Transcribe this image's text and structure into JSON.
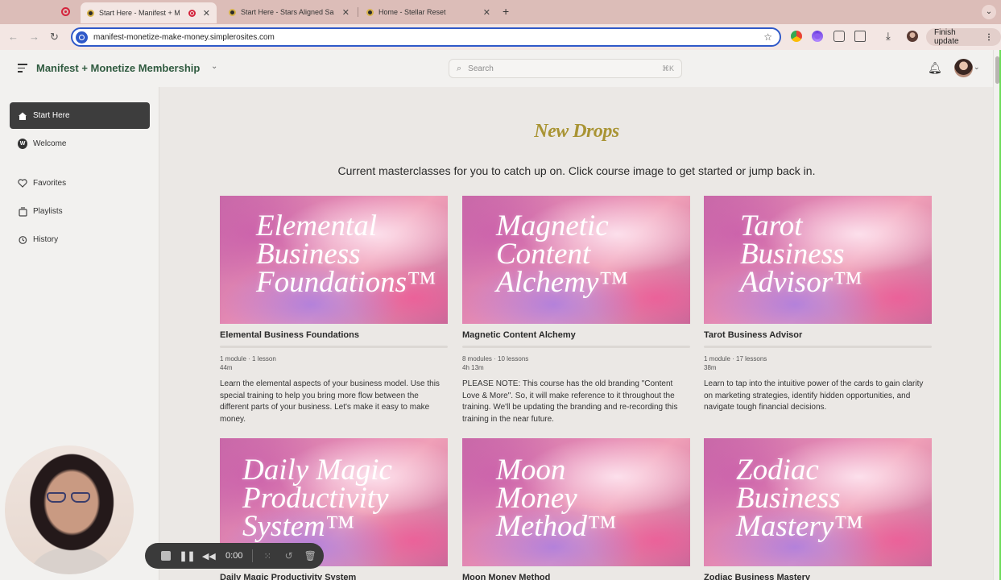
{
  "browser": {
    "tabs": [
      {
        "title": "Start Here - Manifest + M",
        "active": true
      },
      {
        "title": "Start Here - Stars Aligned Sa",
        "active": false
      },
      {
        "title": "Home - Stellar Reset",
        "active": false
      }
    ],
    "url": "manifest-monetize-make-money.simplerosites.com",
    "update_label": "Finish update"
  },
  "header": {
    "site_title": "Manifest + Monetize Membership",
    "search_placeholder": "Search",
    "search_shortcut": "⌘K"
  },
  "sidebar": {
    "items": [
      {
        "label": "Start Here",
        "icon": "home-icon",
        "active": true
      },
      {
        "label": "Welcome",
        "icon": "w-badge-icon",
        "badge": "W",
        "active": false
      },
      {
        "label": "Favorites",
        "icon": "heart-icon",
        "active": false
      },
      {
        "label": "Playlists",
        "icon": "playlist-icon",
        "active": false
      },
      {
        "label": "History",
        "icon": "history-icon",
        "active": false
      }
    ]
  },
  "main": {
    "section_title": "New Drops",
    "section_subtitle": "Current masterclasses for you to catch up on. Click course image to get started or jump back in.",
    "courses": [
      {
        "thumb_text": "Elemental\nBusiness\nFoundations™",
        "title": "Elemental Business Foundations",
        "meta_counts": "1 module · 1 lesson",
        "meta_duration": "44m",
        "description": "Learn the elemental aspects of your business model. Use this special training to help you bring more flow between the different parts of your business. Let's make it easy to make money."
      },
      {
        "thumb_text": "Magnetic\nContent\nAlchemy™",
        "title": "Magnetic Content Alchemy",
        "meta_counts": "8 modules · 10 lessons",
        "meta_duration": "4h 13m",
        "description": "PLEASE NOTE: This course has the old branding \"Content Love & More\". So, it will make reference to it throughout the training. We'll be updating the branding and re-recording this training in the near future."
      },
      {
        "thumb_text": "Tarot\nBusiness\nAdvisor™",
        "title": "Tarot Business Advisor",
        "meta_counts": "1 module · 17 lessons",
        "meta_duration": "38m",
        "description": "Learn to tap into the intuitive power of the cards to gain clarity on marketing strategies, identify hidden opportunities, and navigate tough financial decisions."
      },
      {
        "thumb_text": "Daily Magic\nProductivity\nSystem™",
        "title": "Daily Magic Productivity System",
        "meta_counts": "",
        "meta_duration": "",
        "description": ""
      },
      {
        "thumb_text": "Moon\nMoney\nMethod™",
        "title": "Moon Money Method",
        "meta_counts": "",
        "meta_duration": "",
        "description": ""
      },
      {
        "thumb_text": "Zodiac\nBusiness\nMastery™",
        "title": "Zodiac Business Mastery",
        "meta_counts": "",
        "meta_duration": "",
        "description": ""
      }
    ]
  },
  "recorder": {
    "time": "0:00"
  },
  "colors": {
    "brand_green": "#2f5a3f",
    "accent_gold": "#a99434",
    "active_nav": "#3d3d3d"
  }
}
